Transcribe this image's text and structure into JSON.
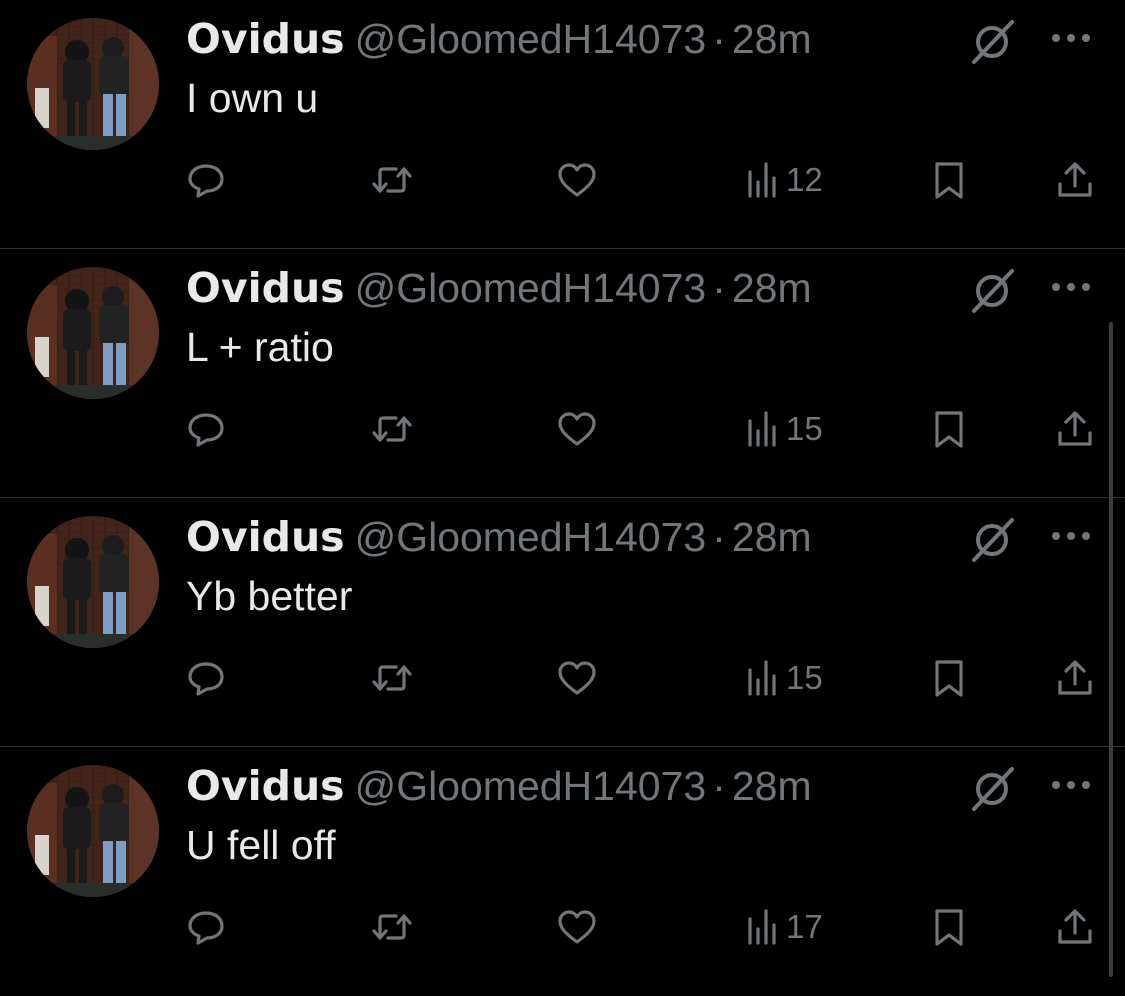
{
  "tweets": [
    {
      "name": "Ovidus",
      "handle": "@GloomedH14073",
      "separator": "·",
      "time": "28m",
      "text": "I own u",
      "views": "12"
    },
    {
      "name": "Ovidus",
      "handle": "@GloomedH14073",
      "separator": "·",
      "time": "28m",
      "text": "L + ratio",
      "views": "15"
    },
    {
      "name": "Ovidus",
      "handle": "@GloomedH14073",
      "separator": "·",
      "time": "28m",
      "text": "Yb better",
      "views": "15"
    },
    {
      "name": "Ovidus",
      "handle": "@GloomedH14073",
      "separator": "·",
      "time": "28m",
      "text": "U fell off",
      "views": "17"
    }
  ],
  "icons": {
    "reply": "reply-icon",
    "retweet": "retweet-icon",
    "like": "heart-icon",
    "views": "views-chart-icon",
    "bookmark": "bookmark-icon",
    "share": "share-icon",
    "grok": "grok-icon",
    "more": "more-icon"
  },
  "colors": {
    "background": "#000000",
    "primary_text": "#e7e9ea",
    "secondary_text": "#71767b",
    "divider": "#2f3336"
  }
}
